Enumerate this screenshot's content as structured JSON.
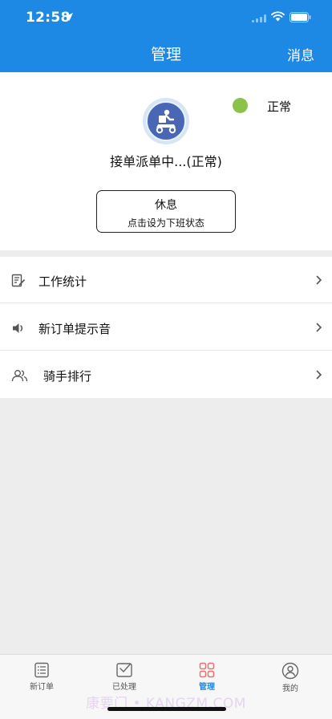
{
  "status_bar": {
    "time": "12:58"
  },
  "nav": {
    "title": "管理",
    "right_action": "消息"
  },
  "profile": {
    "status_indicator_label": "正常",
    "status_color": "#8bc34a",
    "rider_status_text": "接单派单中...(正常)",
    "rest_button": {
      "title": "休息",
      "subtitle": "点击设为下班状态"
    }
  },
  "menu": {
    "items": [
      {
        "label": "工作统计",
        "icon": "edit-doc-icon"
      },
      {
        "label": "新订单提示音",
        "icon": "speaker-icon"
      },
      {
        "label": "骑手排行",
        "icon": "users-icon"
      }
    ]
  },
  "tab_bar": {
    "tabs": [
      {
        "label": "新订单",
        "icon": "list-icon",
        "active": false
      },
      {
        "label": "已处理",
        "icon": "check-mail-icon",
        "active": false
      },
      {
        "label": "管理",
        "icon": "grid-icon",
        "active": true
      },
      {
        "label": "我的",
        "icon": "user-icon",
        "active": false
      }
    ]
  },
  "watermark": "康要门 • KANGZM.COM",
  "colors": {
    "accent": "#1e88e5",
    "status_ok": "#8bc34a",
    "active_tab_icon": "#e57373"
  }
}
